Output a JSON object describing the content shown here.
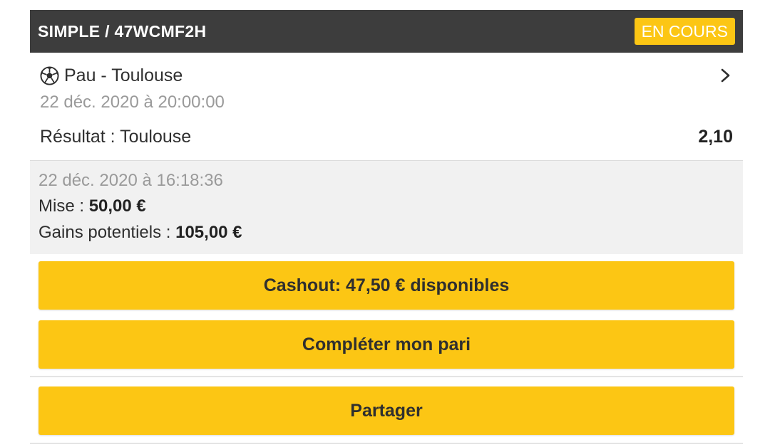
{
  "header": {
    "title": "SIMPLE / 47WCMF2H",
    "status": "EN COURS"
  },
  "event": {
    "match": "Pau - Toulouse",
    "date": "22 déc. 2020 à 20:00:00",
    "result_label": "Résultat : Toulouse",
    "odds": "2,10"
  },
  "summary": {
    "date": "22 déc. 2020 à 16:18:36",
    "stake_label": "Mise : ",
    "stake_value": "50,00 €",
    "gains_label": "Gains potentiels : ",
    "gains_value": "105,00 €"
  },
  "buttons": {
    "cashout": "Cashout: 47,50 € disponibles",
    "complete": "Compléter mon pari",
    "share": "Partager"
  },
  "colors": {
    "accent": "#fcc614",
    "header_bg": "#3d3d3d"
  },
  "icons": {
    "sport": "soccer-ball-icon",
    "nav": "chevron-right-icon"
  }
}
